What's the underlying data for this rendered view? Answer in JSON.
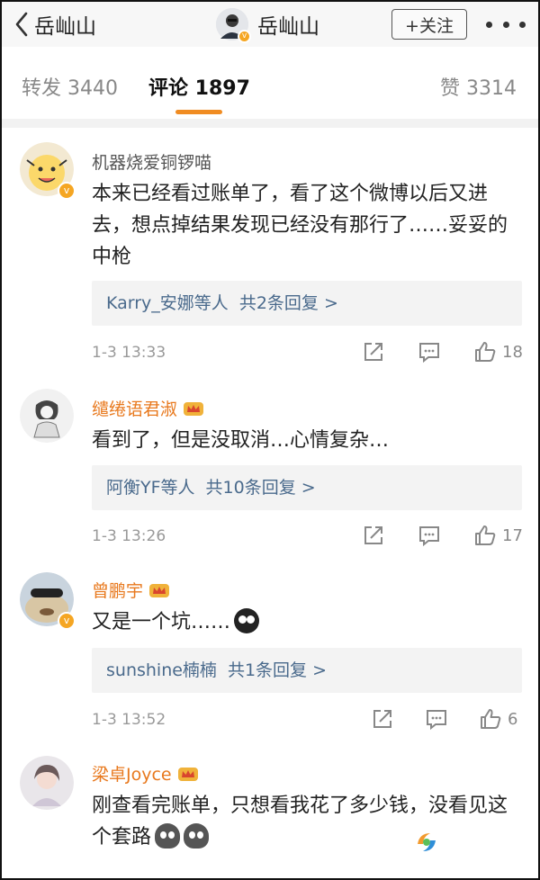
{
  "header": {
    "back_label": "岳屾山",
    "title": "岳屾山",
    "follow_label": "+关注"
  },
  "tabs": {
    "repost": "转发 3440",
    "comment": "评论 1897",
    "like": "赞 3314"
  },
  "colors": {
    "accent": "#f08c22",
    "username_vip": "#e8791e",
    "reply_link": "#4a6a8c"
  },
  "comments": [
    {
      "username": "机器烧爱铜锣喵",
      "text": "本来已经看过账单了，看了这个微博以后又进去，想点掉结果发现已经没有那行了……妥妥的中枪",
      "reply_summary": "Karry_安娜等人",
      "reply_count": "共2条回复 >",
      "time": "1-3 13:33",
      "likes": "18"
    },
    {
      "username": "缱绻语君淑",
      "text": "看到了，但是没取消…心情复杂…",
      "reply_summary": "阿衡YF等人",
      "reply_count": "共10条回复 >",
      "time": "1-3 13:26",
      "likes": "17"
    },
    {
      "username": "曾鹏宇",
      "text": "又是一个坑……",
      "reply_summary": "sunshine楠楠",
      "reply_count": "共1条回复 >",
      "time": "1-3 13:52",
      "likes": "6"
    },
    {
      "username": "梁卓Joyce",
      "text": "刚查看完账单，只想看我花了多少钱，没看见这个套路"
    }
  ]
}
